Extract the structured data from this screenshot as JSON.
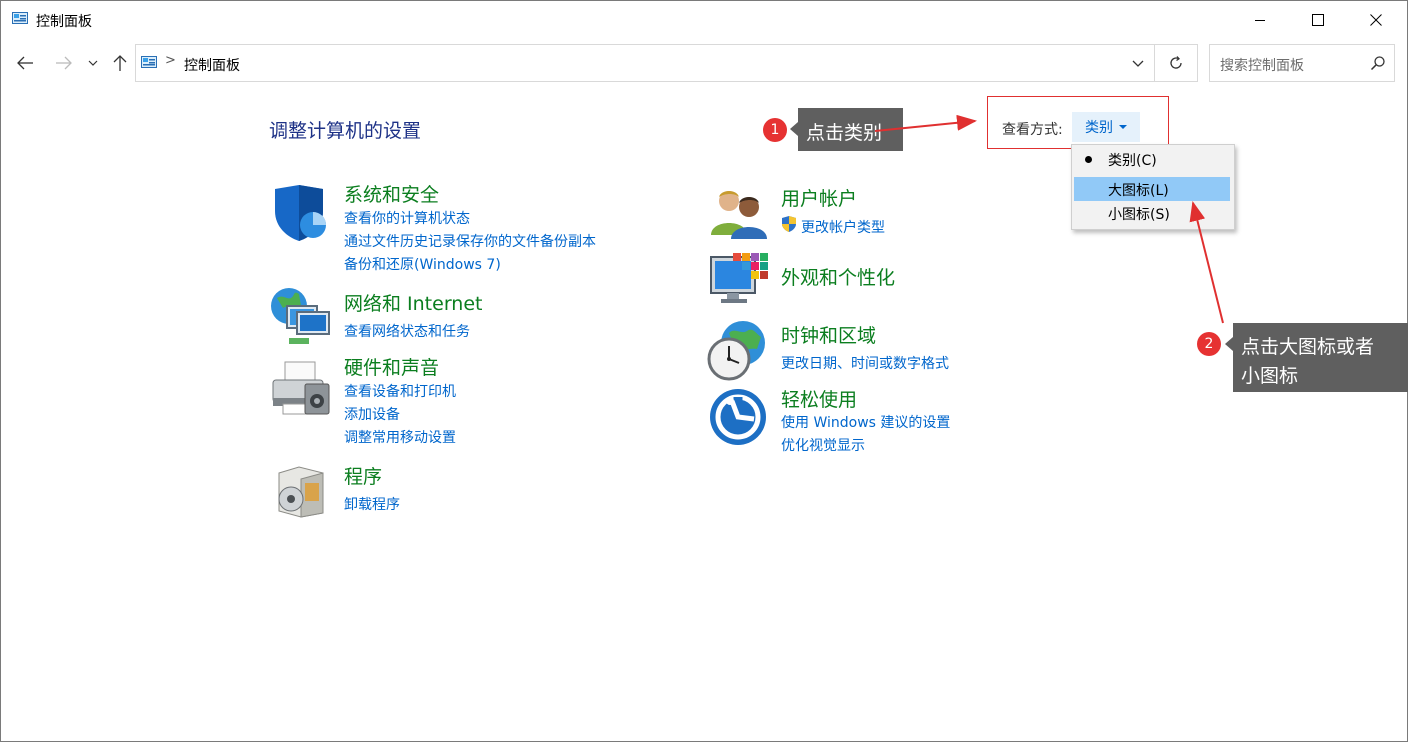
{
  "window": {
    "title": "控制面板",
    "buttons": [
      "minimize",
      "maximize",
      "close"
    ]
  },
  "addressbar": {
    "path": "控制面板",
    "separator": ">",
    "search_placeholder": "搜索控制面板"
  },
  "page_title": "调整计算机的设置",
  "view_by": {
    "label": "查看方式:",
    "value": "类别",
    "menu": [
      {
        "label": "类别(C)",
        "selected": true
      },
      {
        "label": "大图标(L)",
        "highlighted": true
      },
      {
        "label": "小图标(S)"
      }
    ]
  },
  "categories_left": [
    {
      "title": "系统和安全",
      "links": [
        "查看你的计算机状态",
        "通过文件历史记录保存你的文件备份副本",
        "备份和还原(Windows 7)"
      ]
    },
    {
      "title": "网络和 Internet",
      "links": [
        "查看网络状态和任务"
      ]
    },
    {
      "title": "硬件和声音",
      "links": [
        "查看设备和打印机",
        "添加设备",
        "调整常用移动设置"
      ]
    },
    {
      "title": "程序",
      "links": [
        "卸载程序"
      ]
    }
  ],
  "categories_right": [
    {
      "title": "用户帐户",
      "links": [
        "更改帐户类型"
      ]
    },
    {
      "title": "外观和个性化",
      "links": []
    },
    {
      "title": "时钟和区域",
      "links": [
        "更改日期、时间或数字格式"
      ]
    },
    {
      "title": "轻松使用",
      "links": [
        "使用 Windows 建议的设置",
        "优化视觉显示"
      ]
    }
  ],
  "annotations": [
    {
      "number": "1",
      "text": "点击类别"
    },
    {
      "number": "2",
      "text_line1": "点击大图标或者",
      "text_line2": "小图标"
    }
  ],
  "colors": {
    "category_title": "#0b7e1f",
    "link": "#0066cc",
    "page_title": "#1e3287",
    "annotation_red": "#e63232",
    "callout_bg": "#5f5f5f",
    "menu_highlight": "#91c9f7"
  }
}
